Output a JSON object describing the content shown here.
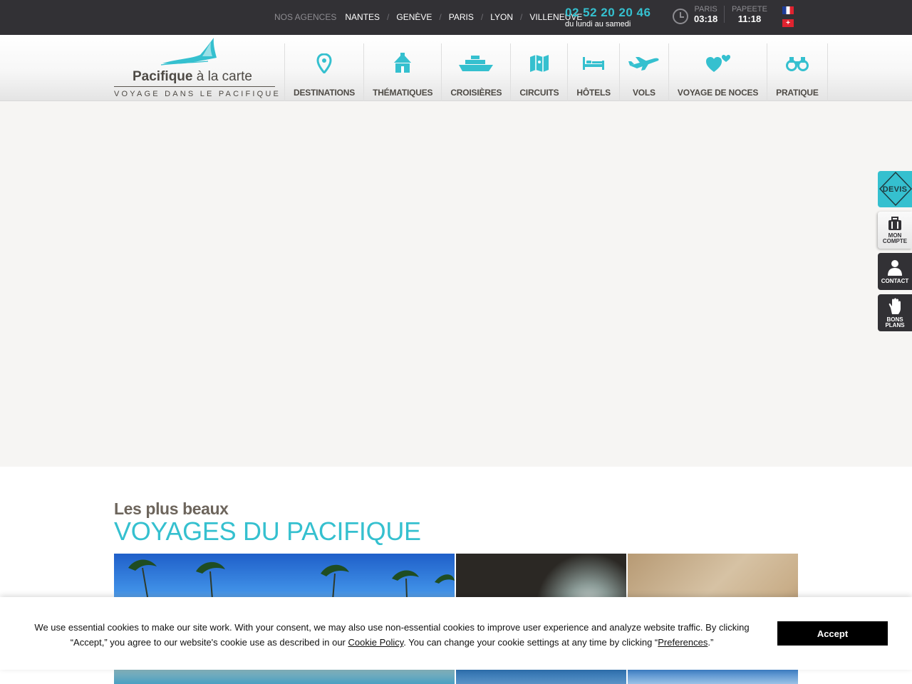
{
  "topbar": {
    "agencies_label": "NOS AGENCES",
    "agencies": [
      "NANTES",
      "GENÈVE",
      "PARIS",
      "LYON",
      "VILLENEUVE"
    ],
    "separator": "/",
    "phone": "02 52 20 20 46",
    "phone_hours": "du lundi au samedi",
    "clock_icon": "clock-icon",
    "times": [
      {
        "city": "PARIS",
        "time": "03:18"
      },
      {
        "city": "PAPEETE",
        "time": "11:18"
      }
    ],
    "flags": [
      "flag-france",
      "flag-switzerland"
    ],
    "swiss_cross": "+"
  },
  "logo": {
    "name_bold": "Pacifique",
    "name_rest": " à la carte",
    "tagline": "VOYAGE DANS LE PACIFIQUE",
    "icon": "manta-ray-logo",
    "color": "#35c0cf"
  },
  "nav": {
    "items": [
      {
        "label": "DESTINATIONS",
        "icon": "map-pin-icon"
      },
      {
        "label": "THÉMATIQUES",
        "icon": "hut-icon"
      },
      {
        "label": "CROISIÈRES",
        "icon": "ship-icon"
      },
      {
        "label": "CIRCUITS",
        "icon": "map-icon"
      },
      {
        "label": "HÔTELS",
        "icon": "bed-icon"
      },
      {
        "label": "VOLS",
        "icon": "airplane-icon"
      },
      {
        "label": "VOYAGE DE NOCES",
        "icon": "hearts-icon"
      },
      {
        "label": "PRATIQUE",
        "icon": "binoculars-icon"
      }
    ]
  },
  "side_tabs": {
    "devis": "DEVIS",
    "compte": "MON COMPTE",
    "contact": "CONTACT",
    "bons_plans": "BONS PLANS"
  },
  "section": {
    "subtitle": "Les plus beaux",
    "title": "VOYAGES DU PACIFIQUE"
  },
  "cookie": {
    "text_1": "We use essential cookies to make our site work. With your consent, we may also use non-essential cookies to improve user experience and analyze website traffic. By clicking “Accept,” you agree to our website's cookie use as described in our ",
    "cookie_policy_link": "Cookie Policy",
    "text_2": ". You can change your cookie settings at any time by clicking “",
    "preferences_link": "Preferences",
    "text_3": ".”",
    "accept_label": "Accept"
  },
  "colors": {
    "accent": "#35c0cf",
    "topbar_bg": "#323135",
    "text_brown": "#4e4a45"
  }
}
